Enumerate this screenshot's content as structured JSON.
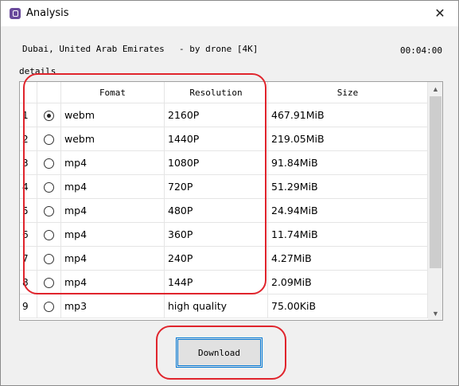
{
  "window": {
    "title": "Analysis",
    "app_icon": "app-icon",
    "close_icon": "close-icon"
  },
  "info": {
    "video_title": "Dubai, United Arab Emirates",
    "author": "- by drone [4K]",
    "duration": "00:04:00",
    "details_label": "details"
  },
  "table": {
    "columns": [
      "Fomat",
      "Resolution",
      "Size"
    ],
    "rows": [
      {
        "index": "1",
        "selected": true,
        "format": "webm",
        "resolution": "2160P",
        "size": "467.91MiB"
      },
      {
        "index": "2",
        "selected": false,
        "format": "webm",
        "resolution": "1440P",
        "size": "219.05MiB"
      },
      {
        "index": "3",
        "selected": false,
        "format": "mp4",
        "resolution": "1080P",
        "size": "91.84MiB"
      },
      {
        "index": "4",
        "selected": false,
        "format": "mp4",
        "resolution": "720P",
        "size": "51.29MiB"
      },
      {
        "index": "5",
        "selected": false,
        "format": "mp4",
        "resolution": "480P",
        "size": "24.94MiB"
      },
      {
        "index": "6",
        "selected": false,
        "format": "mp4",
        "resolution": "360P",
        "size": "11.74MiB"
      },
      {
        "index": "7",
        "selected": false,
        "format": "mp4",
        "resolution": "240P",
        "size": "4.27MiB"
      },
      {
        "index": "8",
        "selected": false,
        "format": "mp4",
        "resolution": "144P",
        "size": "2.09MiB"
      },
      {
        "index": "9",
        "selected": false,
        "format": "mp3",
        "resolution": "high quality",
        "size": "75.00KiB"
      }
    ]
  },
  "download_label": "Download",
  "colors": {
    "annotation": "#e0242c",
    "focus": "#0078d7"
  }
}
